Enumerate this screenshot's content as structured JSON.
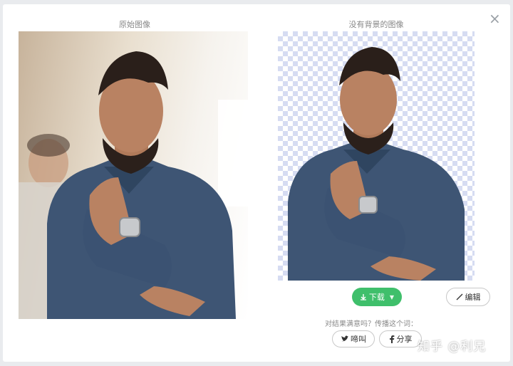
{
  "dialog": {
    "close_symbol": "×",
    "original_title": "原始图像",
    "result_title": "没有背景的图像"
  },
  "actions": {
    "download_label": "下载",
    "edit_label": "编辑",
    "satisfied_text": "对结果满意吗？传播这个词：",
    "tweet_label": "啼叫",
    "share_label": "分享"
  },
  "watermark": "知乎 @利兄",
  "icons": {
    "download": "download-icon",
    "dropdown": "caret-down-icon",
    "edit": "brush-icon",
    "twitter": "twitter-icon",
    "facebook": "facebook-icon"
  },
  "colors": {
    "primary_green": "#3fbf6b",
    "checker_blue": "#d6dcf2",
    "shirt": "#3e5574"
  }
}
